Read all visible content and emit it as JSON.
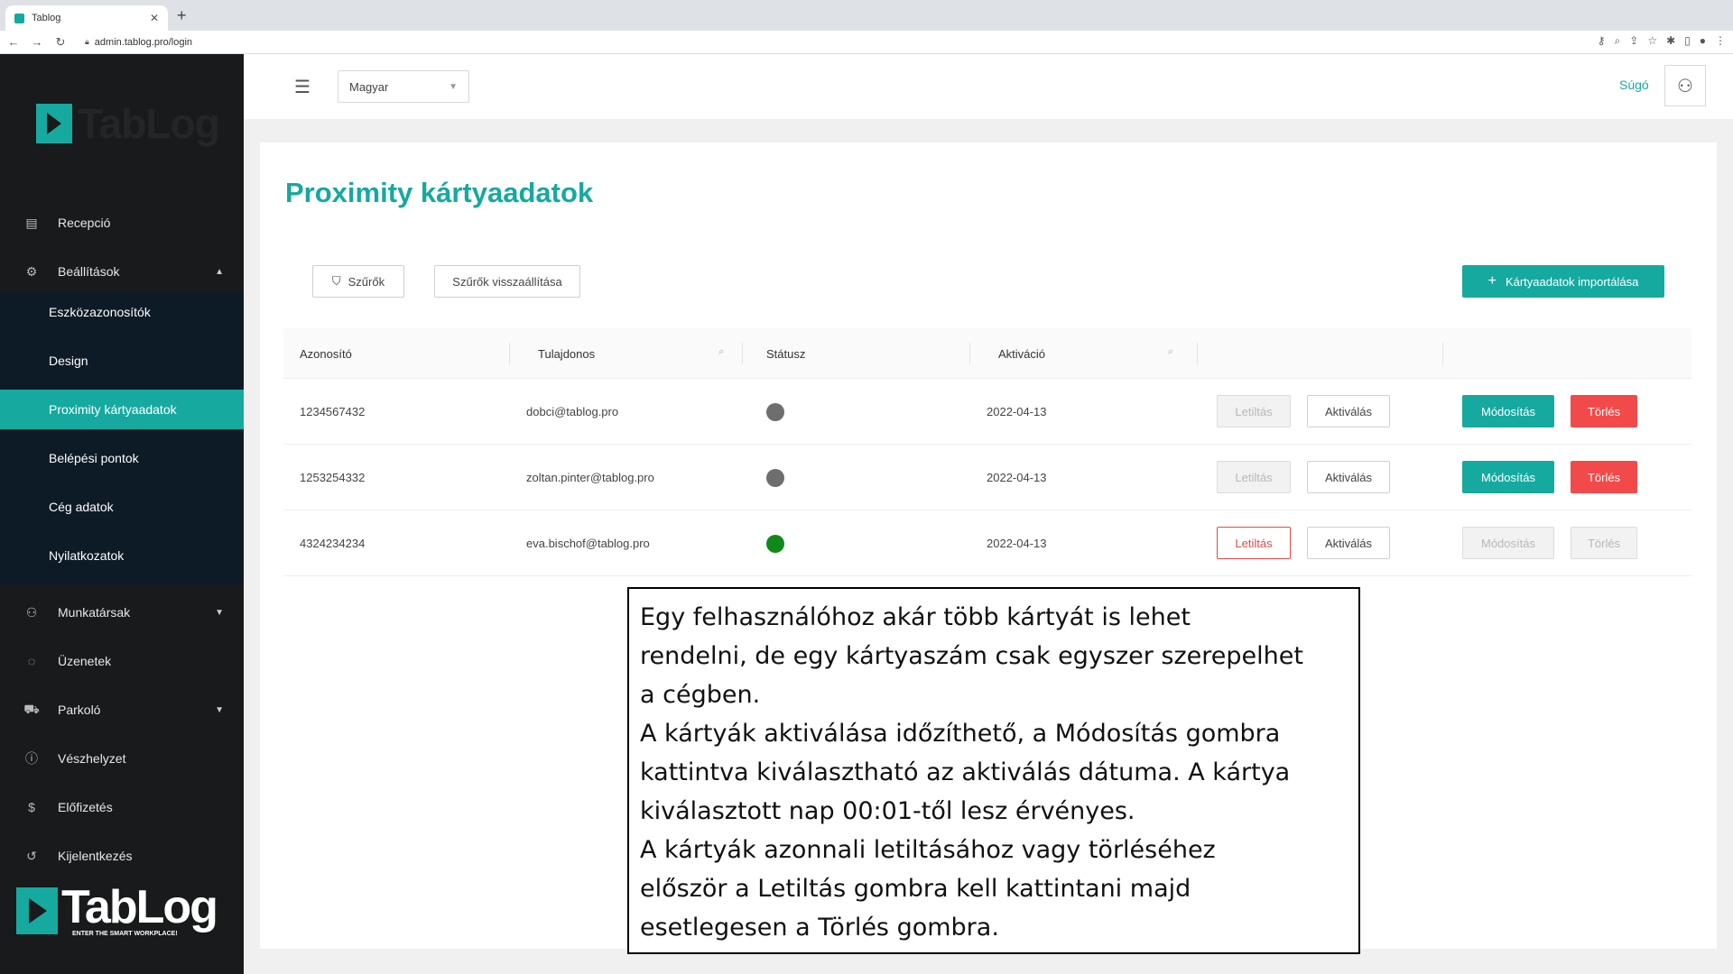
{
  "browser": {
    "tab_title": "Tablog",
    "url": "admin.tablog.pro/login"
  },
  "sidebar": {
    "logo_text": "TabLog",
    "items": [
      {
        "label": "Recepció",
        "icon": "document-icon"
      },
      {
        "label": "Beállítások",
        "icon": "gear-icon",
        "expanded": true
      },
      {
        "label": "Munkatársak",
        "icon": "user-icon"
      },
      {
        "label": "Üzenetek",
        "icon": "chat-icon"
      },
      {
        "label": "Parkoló",
        "icon": "car-icon"
      },
      {
        "label": "Vészhelyzet",
        "icon": "alert-icon"
      },
      {
        "label": "Előfizetés",
        "icon": "dollar-icon"
      },
      {
        "label": "Kijelentkezés",
        "icon": "logout-icon"
      }
    ],
    "submenu": [
      {
        "label": "Eszközazonosítók"
      },
      {
        "label": "Design"
      },
      {
        "label": "Proximity kártyaadatok",
        "active": true
      },
      {
        "label": "Belépési pontok"
      },
      {
        "label": "Cég adatok"
      },
      {
        "label": "Nyilatkozatok"
      }
    ],
    "bottom_logo": {
      "name": "TabLog",
      "tagline": "ENTER THE SMART WORKPLACE!"
    }
  },
  "header": {
    "language": "Magyar",
    "help": "Súgó"
  },
  "main": {
    "title": "Proximity kártyaadatok",
    "filter_button": "Szűrők",
    "reset_filter_button": "Szűrők visszaállítása",
    "import_button": "Kártyaadatok importálása",
    "columns": [
      "Azonosító",
      "Tulajdonos",
      "Státusz",
      "Aktiváció"
    ],
    "rows": [
      {
        "id": "1234567432",
        "owner": "dobci@tablog.pro",
        "status_color": "#6e6e6e",
        "activation": "2022-04-13",
        "block": "Letiltás",
        "activate": "Aktiválás",
        "edit": "Módosítás",
        "delete": "Törlés",
        "block_enabled": false,
        "edit_enabled": true
      },
      {
        "id": "1253254332",
        "owner": "zoltan.pinter@tablog.pro",
        "status_color": "#6e6e6e",
        "activation": "2022-04-13",
        "block": "Letiltás",
        "activate": "Aktiválás",
        "edit": "Módosítás",
        "delete": "Törlés",
        "block_enabled": false,
        "edit_enabled": true
      },
      {
        "id": "4324234234",
        "owner": "eva.bischof@tablog.pro",
        "status_color": "#0f8a1a",
        "activation": "2022-04-13",
        "block": "Letiltás",
        "activate": "Aktiválás",
        "edit": "Módosítás",
        "delete": "Törlés",
        "block_enabled": true,
        "edit_enabled": false
      }
    ]
  },
  "caption": {
    "lines": [
      "Egy felhasználóhoz akár több kártyát is lehet",
      "rendelni, de egy kártyaszám csak egyszer szerepelhet",
      "a cégben.",
      "A kártyák aktiválása időzíthető, a Módosítás gombra",
      "kattintva kiválasztható az aktiválás dátuma. A kártya",
      "kiválasztott nap 00:01-től lesz érvényes.",
      "A kártyák azonnali letiltásához vagy törléséhez",
      "először a Letiltás gombra kell kattintani majd",
      "esetlegesen a Törlés gombra."
    ]
  }
}
